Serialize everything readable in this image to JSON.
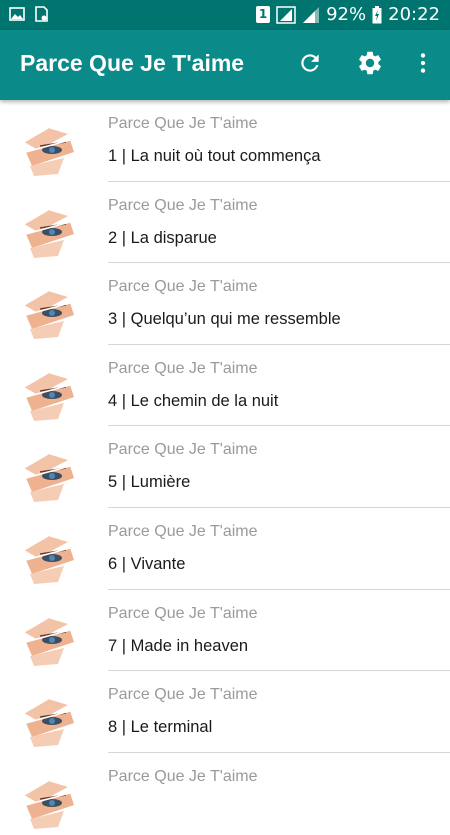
{
  "status_bar": {
    "battery": "92%",
    "time": "20:22",
    "sim_label": "1",
    "icons": [
      "image-icon",
      "sd-card-icon",
      "sim-icon",
      "signal-icon",
      "battery-icon"
    ]
  },
  "app_bar": {
    "title": "Parce Que Je T'aime",
    "icons": [
      "refresh-icon",
      "settings-icon",
      "more-vert-icon"
    ],
    "color": "#0a8a88"
  },
  "list": {
    "items": [
      {
        "subtitle": "Parce Que Je T'aime",
        "title": "1 | La nuit où tout commença"
      },
      {
        "subtitle": "Parce Que Je T'aime",
        "title": "2 | La disparue"
      },
      {
        "subtitle": "Parce Que Je T'aime",
        "title": "3 | Quelqu’un qui me ressemble"
      },
      {
        "subtitle": "Parce Que Je T'aime",
        "title": "4 | Le chemin de la nuit"
      },
      {
        "subtitle": "Parce Que Je T'aime",
        "title": "5 | Lumière"
      },
      {
        "subtitle": "Parce Que Je T'aime",
        "title": "6 | Vivante"
      },
      {
        "subtitle": "Parce Que Je T'aime",
        "title": "7 | Made in heaven"
      },
      {
        "subtitle": "Parce Que Je T'aime",
        "title": "8 | Le terminal"
      },
      {
        "subtitle": "Parce Que Je T'aime",
        "title": ""
      }
    ]
  }
}
